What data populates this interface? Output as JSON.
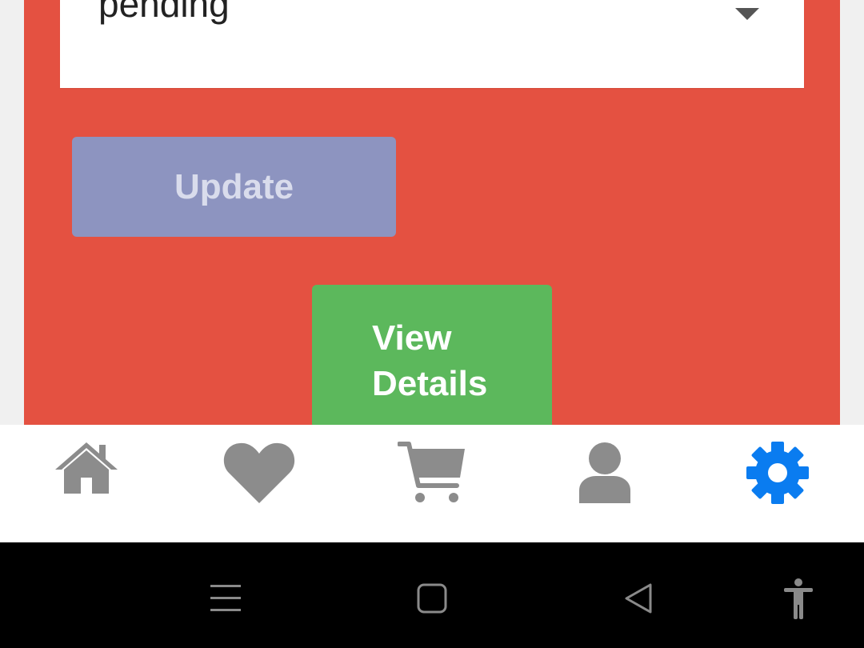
{
  "colors": {
    "card_background": "#e45141",
    "update_button": "#8d94c0",
    "details_button": "#5cb85c",
    "tab_icon_inactive": "#8c8c8c",
    "tab_icon_active": "#0a7cf0",
    "system_nav_background": "#000000"
  },
  "status_select": {
    "value": "pending"
  },
  "buttons": {
    "update_label": "Update",
    "view_details_line1": "View",
    "view_details_line2": "Details"
  },
  "tabbar": {
    "tabs": [
      {
        "icon": "home-icon",
        "active": false
      },
      {
        "icon": "heart-icon",
        "active": false
      },
      {
        "icon": "cart-icon",
        "active": false
      },
      {
        "icon": "user-icon",
        "active": false
      },
      {
        "icon": "gear-icon",
        "active": true
      }
    ]
  },
  "system_nav": {
    "buttons": [
      "menu-icon",
      "home-square-icon",
      "back-icon",
      "accessibility-icon"
    ]
  }
}
